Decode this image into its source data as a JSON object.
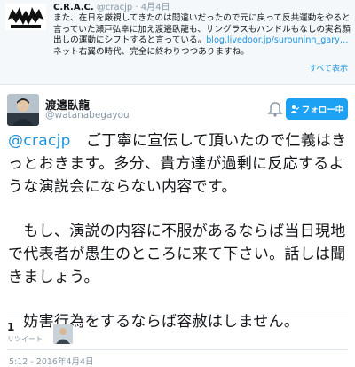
{
  "quoted_tweet": {
    "name": "C.R.A.C.",
    "handle": "@cracjp",
    "separator": " · ",
    "time": "4月4日",
    "text_before_link": "また、在日を厳視してきたのは間違いだったので元に戻って反共運動をやると言っていた瀬戸弘幸に加え渡邉臥龍も、サングラスもハンドルもなしの実名顔出しの運動にシフトすると言っている。",
    "link": "blog.livedoor.jp/surouninn_gary…",
    "text_after_link": " ネット右翼の時代、完全に終わりつつありますね。",
    "see_all": "すべて表示"
  },
  "tweet": {
    "name": "渡邉臥龍",
    "handle": "@watanabegayou",
    "follow_label": "フォロー中",
    "mention": "@cracjp",
    "line1_rest": "　ご丁寧に宣伝して頂いたので仁義はきっとおきます。多分、貴方達が過剰に反応するような演説会にならない内容です。",
    "para2": "　もし、演説の内容に不服があるならば当日現地で代表者が愚生のところに来て下さい。話しは聞きましょう。",
    "para3": "　妨害行為をするならば容赦はしません。"
  },
  "stats": {
    "retweet_count": "1",
    "retweet_label": "リツイート"
  },
  "timestamp": "5:12 - 2016年4月4日",
  "colors": {
    "accent": "#1da1f2",
    "link": "#1b95e0",
    "muted": "#8899a6"
  }
}
